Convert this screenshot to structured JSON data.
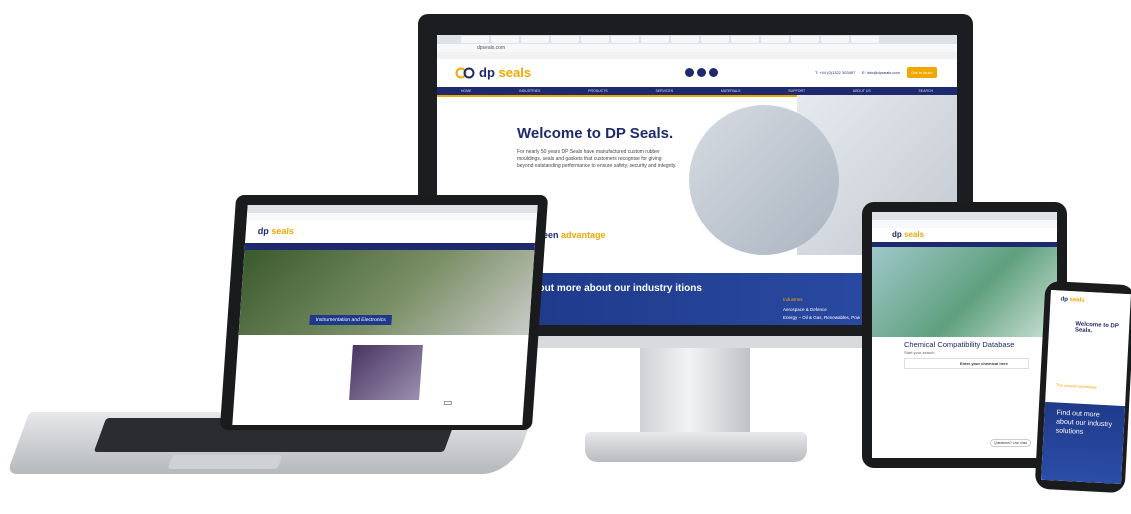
{
  "monitor": {
    "url": "dpseals.com",
    "logo_brand": "dp",
    "logo_suffix": "seals",
    "nav_items": [
      "HOME",
      "INDUSTRIES",
      "PRODUCTS",
      "SERVICES",
      "MATERIALS",
      "SUPPORT",
      "ABOUT US",
      "SEARCH"
    ],
    "phone": "T: +44 (0)1322 303497",
    "email": "E: info@dpseals.com",
    "cta": "Get in touch",
    "welcome_prefix": "Welcome to",
    "welcome_brand": "DP Seals.",
    "intro": "For nearly 50 years DP Seals have manufactured custom rubber mouldings, seals and gaskets that customers recognise for giving beyond outstanding performance to ensure safety, security and integrity.",
    "tagline_prefix": "unseen",
    "tagline_suffix": "advantage",
    "band_text": "l out more about our industry itions",
    "band_text_bold": "industry",
    "industries_title": "Industries",
    "industries_list": [
      "Aerospace & Defence",
      "Energy – Oil & Gas, Renewables, Pow"
    ]
  },
  "laptop": {
    "caption": "Instrumentation and Electronics"
  },
  "tablet": {
    "title": "Chemical Compatibility Database",
    "search_label": "Start your search",
    "search_value": "Enter your chemical here",
    "chat": "Questions? Live chat"
  },
  "phone": {
    "welcome": "Welcome to DP Seals.",
    "tagline": "The unseen advantage",
    "band_text": "Find out more about our industry solutions"
  }
}
